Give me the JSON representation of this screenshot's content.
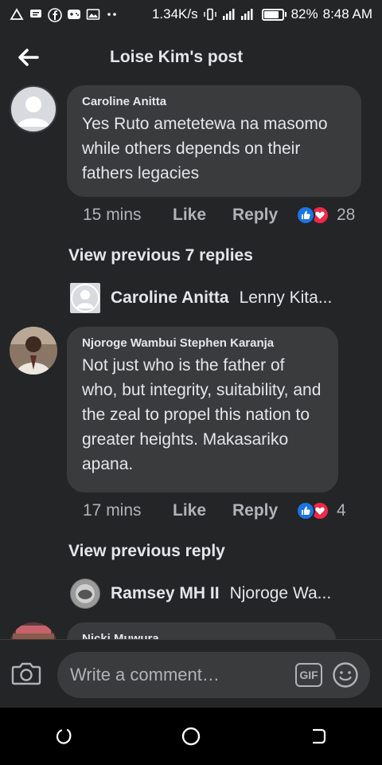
{
  "status_bar": {
    "network_speed": "1.34K/s",
    "battery": "82%",
    "battery_level": 0.82,
    "time": "8:48 AM"
  },
  "header": {
    "title": "Loise Kim's post",
    "back_icon": "arrow-left-icon"
  },
  "comments": [
    {
      "author": "Caroline Anitta",
      "text": "Yes Ruto ametetewa na masomo while others depends on their fathers legacies",
      "time": "15 mins",
      "like_label": "Like",
      "reply_label": "Reply",
      "reaction_count": "28",
      "view_previous": "View previous 7 replies",
      "reply_preview": {
        "name": "Caroline Anitta",
        "snippet": "Lenny Kita..."
      }
    },
    {
      "author": "Njoroge Wambui Stephen Karanja",
      "text": "Not just who is the father of who, but integrity, suitability, and the zeal to propel this nation to greater heights. Makasariko apana.",
      "time": "17 mins",
      "like_label": "Like",
      "reply_label": "Reply",
      "reaction_count": "4",
      "view_previous": "View previous reply",
      "reply_preview": {
        "name": "Ramsey MH II",
        "snippet": "Njoroge Wa..."
      }
    },
    {
      "author": "Nicki Muwura"
    }
  ],
  "composer": {
    "placeholder": "Write a comment…",
    "gif_label": "GIF"
  },
  "colors": {
    "background": "#242526",
    "bubble": "#3a3b3c",
    "text_primary": "#e4e6eb",
    "text_secondary": "#b0b3b8",
    "like_blue": "#1b74e4",
    "love_red": "#f02849"
  }
}
